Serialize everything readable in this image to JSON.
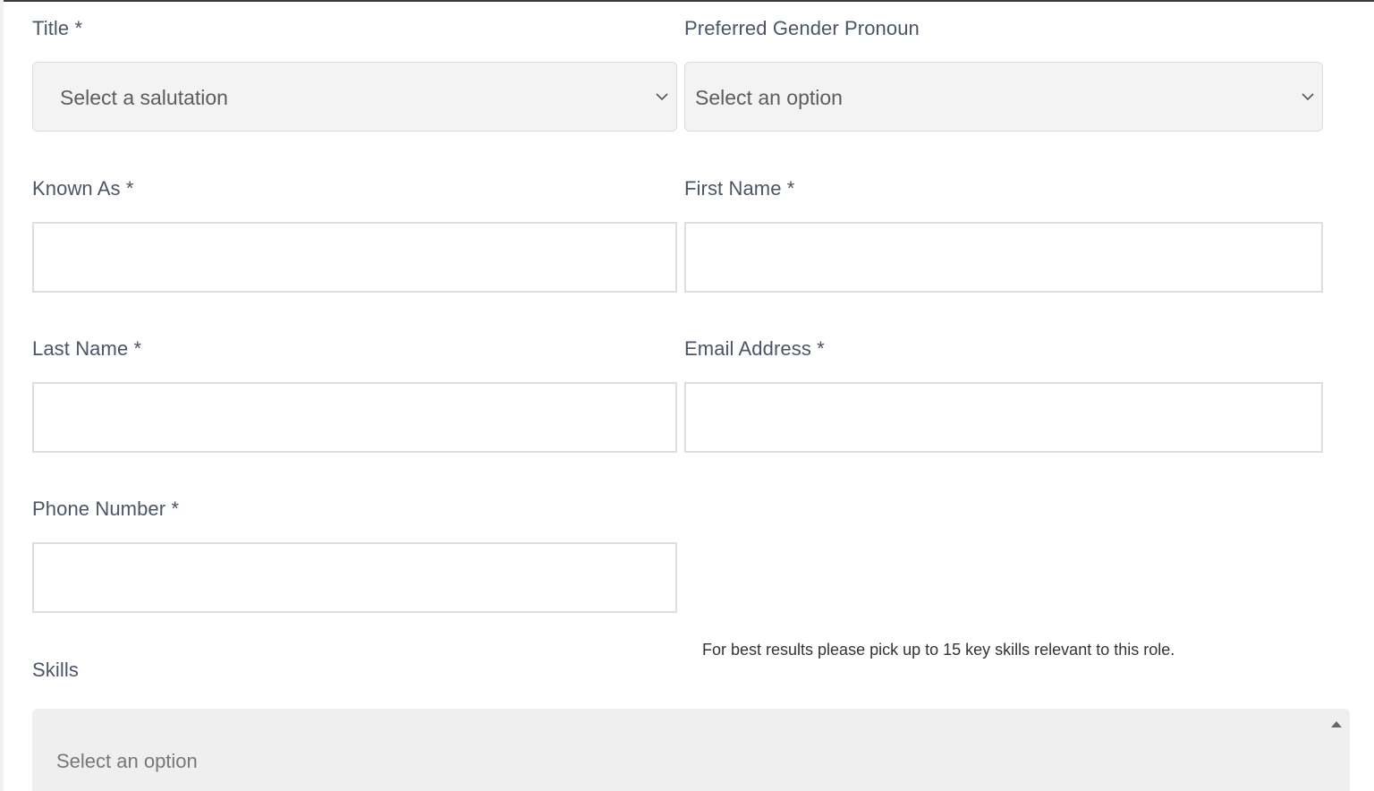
{
  "form": {
    "title": {
      "label": "Title *",
      "value": "Select a salutation",
      "icon": "chevron-down-icon"
    },
    "pronoun": {
      "label": "Preferred Gender Pronoun",
      "value": "Select an option",
      "icon": "chevron-down-icon"
    },
    "known_as": {
      "label": "Known As *",
      "value": ""
    },
    "first_name": {
      "label": "First Name *",
      "value": ""
    },
    "last_name": {
      "label": "Last Name *",
      "value": ""
    },
    "email": {
      "label": "Email Address *",
      "value": ""
    },
    "phone": {
      "label": "Phone Number *",
      "value": ""
    },
    "skills": {
      "label": "Skills",
      "hint": "For best results please pick up to 15 key skills relevant to this role.",
      "placeholder": "Select an option",
      "icon": "caret-up-icon"
    }
  },
  "colors": {
    "label_text": "#4a5567",
    "select_bg": "#f3f3f3",
    "input_border": "#dedede",
    "skills_bg": "#efefef"
  }
}
